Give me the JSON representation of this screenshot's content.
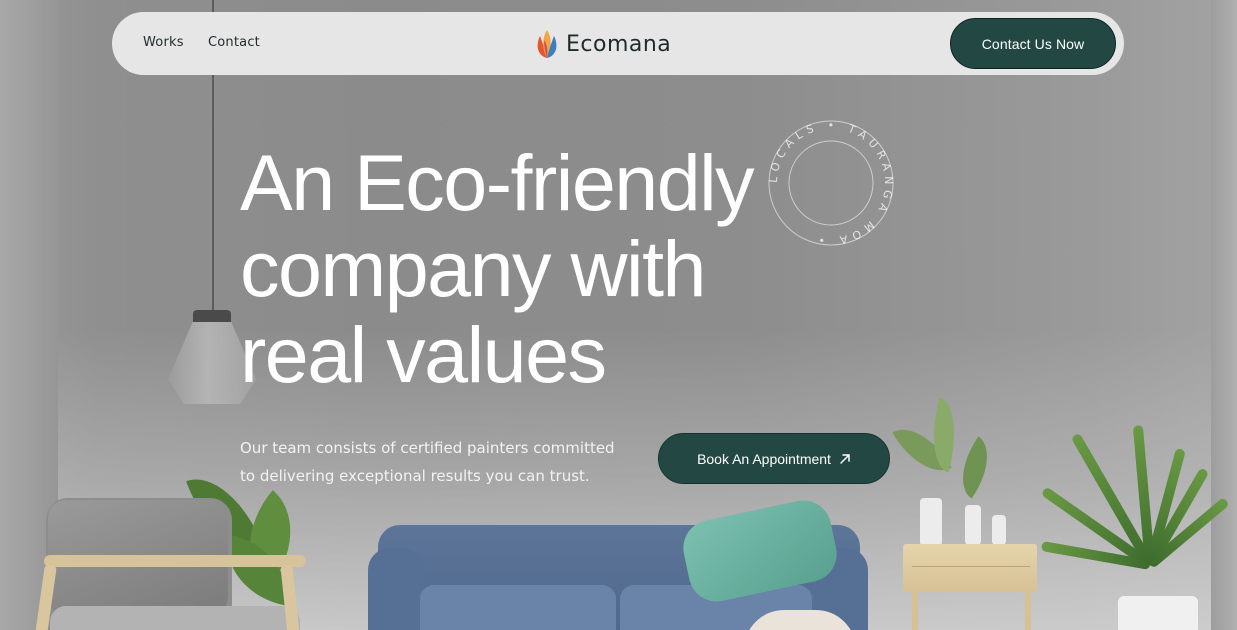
{
  "nav": {
    "links": [
      {
        "label": "Works"
      },
      {
        "label": "Contact"
      }
    ],
    "brand": "Ecomana",
    "cta_label": "Contact Us Now"
  },
  "hero": {
    "title_lines": [
      "An Eco-friendly",
      "company with",
      "real values"
    ],
    "description_lines": [
      "Our team consists of certified painters committed",
      "to delivering exceptional results you can trust."
    ],
    "button_label": "Book An Appointment"
  },
  "badge": {
    "text": "LOCALS • TAURANGA MOA • "
  },
  "colors": {
    "accent": "#234843",
    "nav_bg": "#e6e6e6",
    "text_dark": "#1f2b2a"
  },
  "icons": {
    "arrow": "arrow-up-right-icon",
    "logo": "leaf-logo-icon"
  }
}
